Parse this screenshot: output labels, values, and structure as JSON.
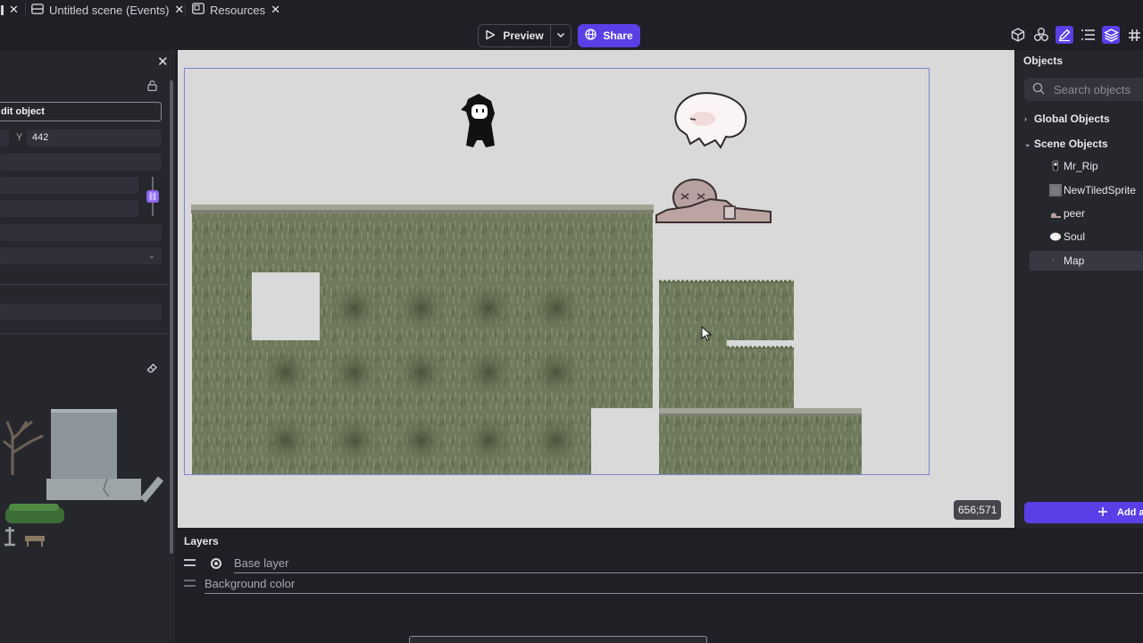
{
  "tabs": [
    {
      "label": "",
      "close": "✕",
      "icon": "none"
    },
    {
      "label": "Untitled scene (Events)",
      "close": "✕",
      "icon": "events-list-icon"
    },
    {
      "label": "Resources",
      "close": "✕",
      "icon": "resources-icon"
    }
  ],
  "toolbar": {
    "preview_label": "Preview",
    "share_label": "Share",
    "icons": [
      "object-cube-icon",
      "object-groups-icon",
      "edit-pencil-icon",
      "events-list-icon",
      "layers-icon",
      "grid-icon"
    ]
  },
  "properties": {
    "edit_object_label": "dit object",
    "y_label": "Y",
    "y_value": "442"
  },
  "canvas": {
    "coordinates": "656;571"
  },
  "objects_panel": {
    "title": "Objects",
    "search_placeholder": "Search objects",
    "global_objects_label": "Global Objects",
    "scene_objects_label": "Scene Objects",
    "items": [
      {
        "label": "Mr_Rip",
        "icon": "mr-rip-thumbnail"
      },
      {
        "label": "NewTiledSprite",
        "icon": "tiled-sprite-thumbnail"
      },
      {
        "label": "peer",
        "icon": "peer-thumbnail"
      },
      {
        "label": "Soul",
        "icon": "soul-thumbnail"
      },
      {
        "label": "Map",
        "icon": "map-thumbnail",
        "selected": true
      }
    ],
    "add_label": "Add a"
  },
  "layers": {
    "title": "Layers",
    "base_layer_label": "Base layer",
    "background_color_label": "Background color"
  },
  "colors": {
    "accent": "#5b3fe6",
    "panel": "#26262d",
    "canvas": "#d9d9d9",
    "selection_border": "#7b83d6"
  }
}
